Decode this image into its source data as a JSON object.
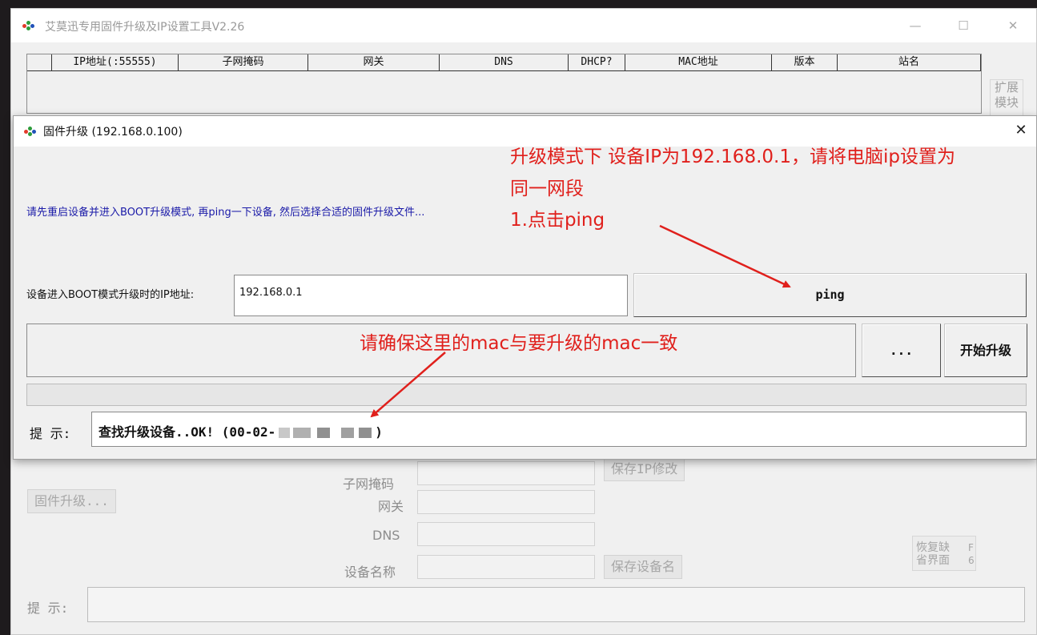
{
  "main_window": {
    "title": "艾莫迅专用固件升级及IP设置工具V2.26",
    "controls": {
      "minimize": "—",
      "maximize": "☐",
      "close": "✕"
    },
    "columns": [
      "",
      "IP地址(:55555)",
      "子网掩码",
      "网关",
      "DNS",
      "DHCP?",
      "MAC地址",
      "版本",
      "站名"
    ],
    "extend_button": "扩展模块",
    "form": {
      "subnet_label": "子网掩码",
      "gateway_label": "网关",
      "dns_label": "DNS",
      "device_name_label": "设备名称",
      "save_ip_button": "保存IP修改",
      "save_name_button": "保存设备名",
      "firmware_button": "固件升级...",
      "restore_button": "恢复缺省界面",
      "f6_label": "F 6"
    },
    "hint_label": "提 示:"
  },
  "dialog": {
    "title": "固件升级 (192.168.0.100)",
    "close": "✕",
    "instruction": "请先重启设备并进入BOOT升级模式, 再ping一下设备, 然后选择合适的固件升级文件...",
    "ip_label": "设备进入BOOT模式升级时的IP地址:",
    "ip_value": "192.168.0.1",
    "ping_button": "ping",
    "browse_button": "...",
    "upgrade_button": "开始升级",
    "hint_label": "提 示:",
    "hint_text": "查找升级设备..OK! (00-02-",
    "hint_suffix": ")"
  },
  "annotations": {
    "line1": "升级模式下 设备IP为192.168.0.1，请将电脑ip设置为",
    "line2": "同一网段",
    "line3": "1.点击ping",
    "mac_note": "请确保这里的mac与要升级的mac一致"
  },
  "colors": {
    "annotation": "#e0201c",
    "instruction": "#1a1aa8"
  }
}
